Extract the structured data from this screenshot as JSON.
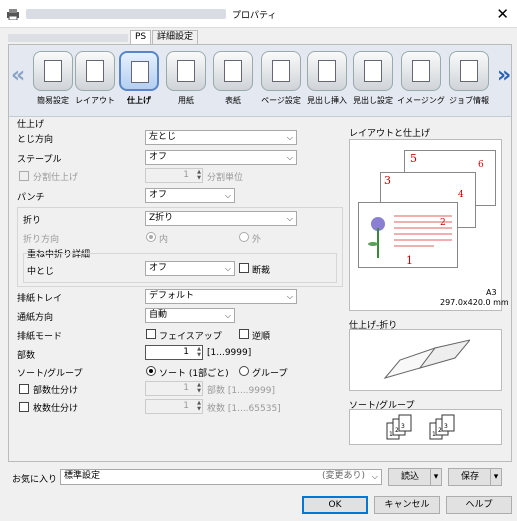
{
  "window": {
    "title": "プロパティ",
    "close_glyph": "✕"
  },
  "tabs": [
    {
      "label": "PS"
    },
    {
      "label": "詳細設定"
    }
  ],
  "categories": [
    {
      "label": "簡易設定",
      "icon": "quick-setup-icon"
    },
    {
      "label": "レイアウト",
      "icon": "layout-icon"
    },
    {
      "label": "仕上げ",
      "icon": "finishing-icon",
      "selected": true
    },
    {
      "label": "用紙",
      "icon": "paper-icon"
    },
    {
      "label": "表紙",
      "icon": "cover-icon"
    },
    {
      "label": "ページ設定",
      "icon": "page-setting-icon"
    },
    {
      "label": "見出し挿入",
      "icon": "tab-insert-icon"
    },
    {
      "label": "見出し設定",
      "icon": "tab-setting-icon"
    },
    {
      "label": "イメージング",
      "icon": "imaging-icon"
    },
    {
      "label": "ジョブ情報",
      "icon": "job-info-icon"
    }
  ],
  "finishing": {
    "section": "仕上げ",
    "binding_label": "とじ方向",
    "binding_value": "左とじ",
    "staple_label": "ステープル",
    "staple_value": "オフ",
    "split_label": "分割仕上げ",
    "split_value": "1",
    "split_unit": "分割単位",
    "punch_label": "パンチ",
    "punch_value": "オフ",
    "fold_label": "折り",
    "fold_value": "Z折り",
    "fold_dir_label": "折り方向",
    "fold_dir_in": "内",
    "fold_dir_out": "外",
    "saddle_label": "重ね中折り詳細",
    "center_label": "中とじ",
    "center_value": "オフ",
    "cut_label": "断裁",
    "tray_label": "排紙トレイ",
    "tray_value": "デフォルト",
    "direction_label": "通紙方向",
    "direction_value": "自動",
    "mode_label": "排紙モード",
    "faceup_label": "フェイスアップ",
    "reverse_label": "逆順",
    "copies_label": "部数",
    "copies_value": "1",
    "copies_range": "[1...9999]",
    "sort_label": "ソート/グループ",
    "sort_option": "ソート (1部ごと)",
    "group_option": "グループ",
    "copy_sep_label": "部数仕分け",
    "copy_sep_value": "1",
    "copy_sep_unit": "部数 [1....9999]",
    "sheet_sep_label": "枚数仕分け",
    "sheet_sep_value": "1",
    "sheet_sep_unit": "枚数 [1....65535]"
  },
  "preview": {
    "layout_title": "レイアウトと仕上げ",
    "paper_size": "A3",
    "paper_dims": "297.0x420.0 mm",
    "fold_title": "仕上げ-折り",
    "sort_title": "ソート/グループ",
    "page_numbers": [
      "5",
      "6",
      "3",
      "4",
      "1",
      "2"
    ]
  },
  "favorites": {
    "label": "お気に入り",
    "value": "標準設定",
    "changed": "(変更あり)",
    "load": "読込",
    "save": "保存"
  },
  "buttons": {
    "ok": "OK",
    "cancel": "キャンセル",
    "help": "ヘルプ"
  },
  "accent": "#0078d7"
}
